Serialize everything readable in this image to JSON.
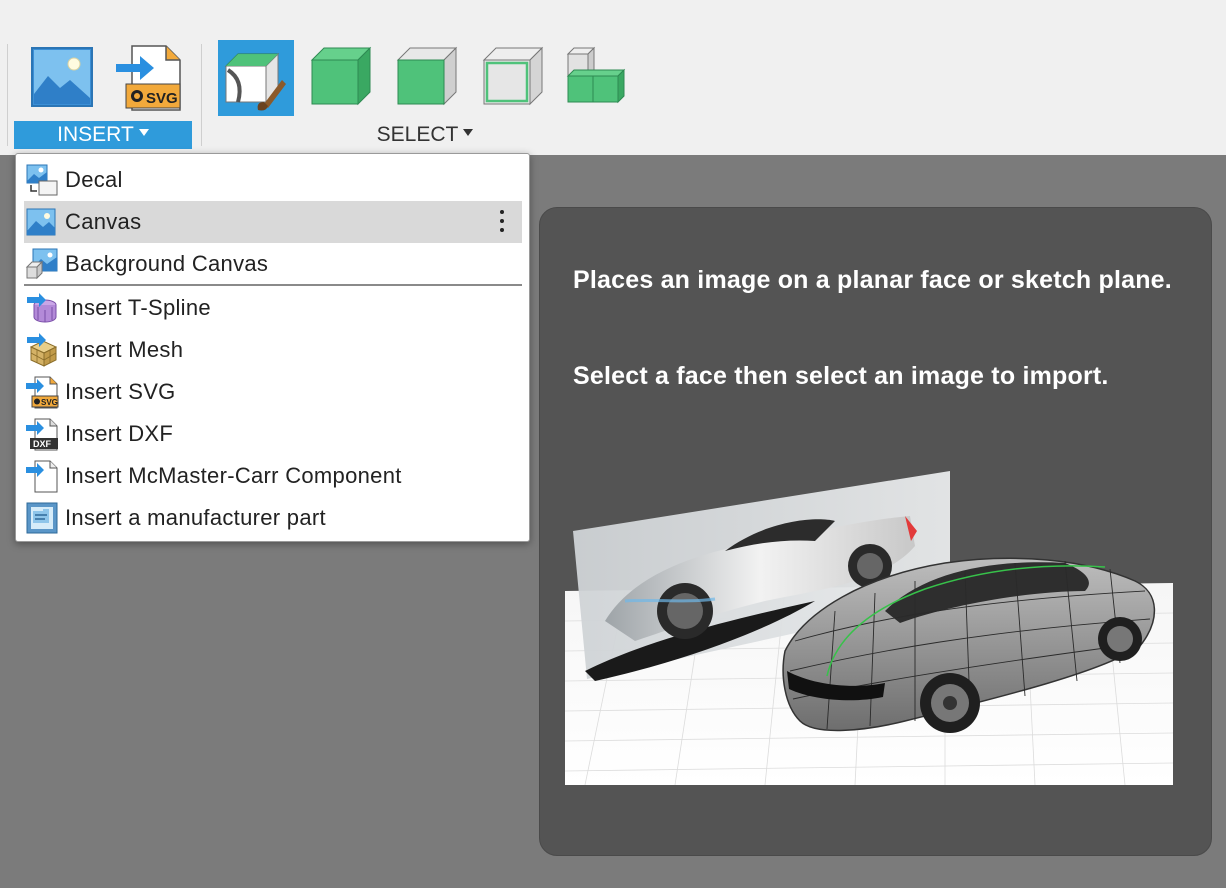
{
  "toolbar": {
    "insert_group_label": "INSERT",
    "select_group_label": "SELECT",
    "buttons": [
      "insert-image-button",
      "insert-svg-button",
      "select-paint-button",
      "select-body-button",
      "select-face-button",
      "select-window-button",
      "select-component-button"
    ],
    "svg_badge_text": "SVG"
  },
  "menu": {
    "items": [
      {
        "label": "Decal",
        "icon": "decal-icon"
      },
      {
        "label": "Canvas",
        "icon": "canvas-icon"
      },
      {
        "label": "Background Canvas",
        "icon": "background-canvas-icon"
      },
      {
        "label": "Insert T-Spline",
        "icon": "tspline-icon"
      },
      {
        "label": "Insert Mesh",
        "icon": "mesh-icon"
      },
      {
        "label": "Insert SVG",
        "icon": "svg-icon"
      },
      {
        "label": "Insert DXF",
        "icon": "dxf-icon"
      },
      {
        "label": "Insert McMaster-Carr Component",
        "icon": "mcmaster-icon"
      },
      {
        "label": "Insert a manufacturer part",
        "icon": "manufacturer-part-icon"
      }
    ],
    "dxf_badge_text": "DXF",
    "svg_badge_text": "SVG"
  },
  "tooltip": {
    "description": "Places an image on a planar face or sketch plane.",
    "instruction": "Select a face then select an image to import."
  },
  "colors": {
    "accent": "#2f9bdb",
    "toolbar_bg": "#f0f0f0",
    "viewport_bg": "#7b7b7b",
    "tooltip_bg": "#545454",
    "menu_hover": "#d9d9d9",
    "green_solid": "#4fc27a"
  }
}
